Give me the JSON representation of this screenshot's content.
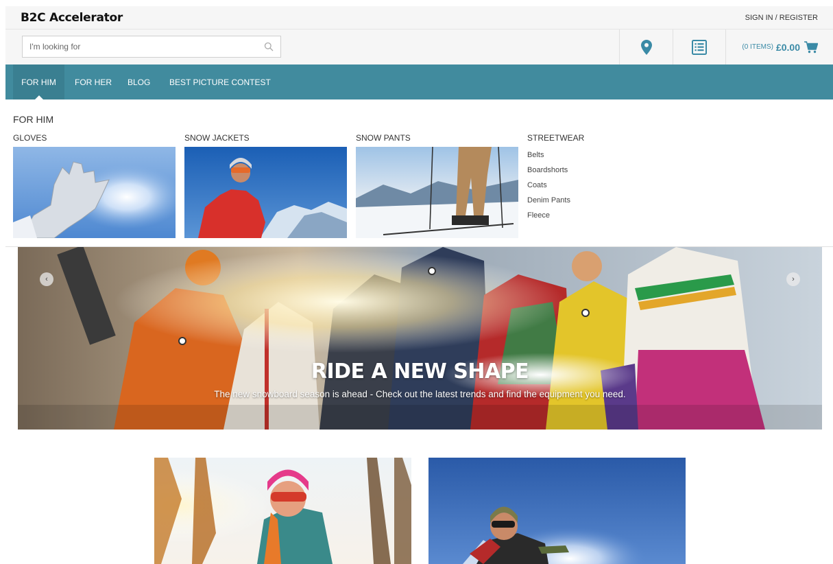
{
  "header": {
    "logo": "B2C Accelerator",
    "signin": "SIGN IN / REGISTER"
  },
  "search": {
    "placeholder": "I'm looking for"
  },
  "cart": {
    "items_label": "(0 ITEMS)",
    "total": "£0.00"
  },
  "nav": {
    "items": [
      {
        "label": "FOR HIM"
      },
      {
        "label": "FOR HER"
      },
      {
        "label": "BLOG"
      },
      {
        "label": "BEST PICTURE CONTEST"
      }
    ]
  },
  "mega": {
    "title": "FOR HIM",
    "columns": [
      {
        "title": "GLOVES"
      },
      {
        "title": "SNOW JACKETS"
      },
      {
        "title": "SNOW PANTS"
      },
      {
        "title": "STREETWEAR"
      }
    ],
    "streetwear_links": [
      "Belts",
      "Boardshorts",
      "Coats",
      "Denim Pants",
      "Fleece"
    ]
  },
  "hero": {
    "title": "RIDE A NEW SHAPE",
    "subtitle": "The new snowboard season is ahead - Check out the latest trends and find the equipment you need."
  },
  "colors": {
    "nav": "#418b9e",
    "accent": "#3a8aa6"
  }
}
